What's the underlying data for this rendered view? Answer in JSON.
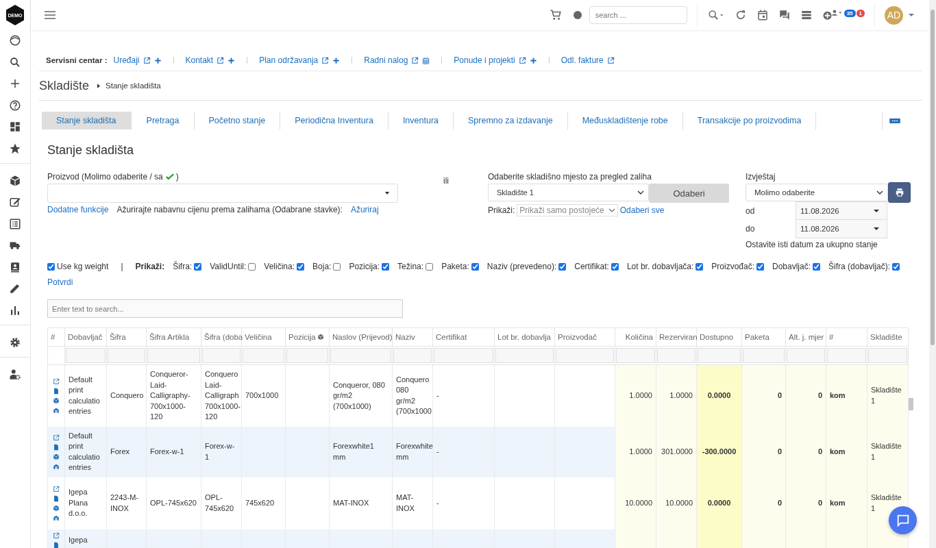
{
  "brand": {
    "logo": "DEMO"
  },
  "topbar": {
    "search": {
      "placeholder": "search ..."
    },
    "badges": [
      {
        "text": "35",
        "color": "#1f6fd6"
      },
      {
        "text": "1",
        "color": "#e5484d"
      }
    ],
    "avatar": "AD"
  },
  "service_center": {
    "label": "Servisni centar :",
    "links": [
      {
        "label": "Uređaji",
        "kind": "add"
      },
      {
        "label": "Kontakt",
        "kind": "add"
      },
      {
        "label": "Plan održavanja",
        "kind": "add"
      },
      {
        "label": "Radni nalog",
        "kind": "calendar"
      },
      {
        "label": "Ponude i projekti",
        "kind": "add"
      },
      {
        "label": "Odl. fakture",
        "kind": "link"
      }
    ]
  },
  "breadcrumb": {
    "title": "Skladište",
    "current": "Stanje skladišta"
  },
  "tabs": [
    {
      "label": "Stanje skladišta",
      "selected": true
    },
    {
      "label": "Pretraga",
      "selected": false
    },
    {
      "label": "Početno stanje",
      "selected": false
    },
    {
      "label": "Periodična Inventura",
      "selected": false
    },
    {
      "label": "Inventura",
      "selected": false
    },
    {
      "label": "Spremno za izdavanje",
      "selected": false
    },
    {
      "label": "Međuskladištenje robe",
      "selected": false
    },
    {
      "label": "Transakcije po proizvodima",
      "selected": false
    }
  ],
  "heading": "Stanje skladišta",
  "product": {
    "label": "Proizvod (Molimo odaberite / sa",
    "label_end": ")",
    "extra_link": "Dodatne funkcije",
    "update_text": "Ažurirajte nabavnu cijenu prema zalihama (Odabrane stavke):",
    "update_link": "Ažuriraj"
  },
  "or_text": "ili",
  "warehouse": {
    "label": "Odaberite skladišno mjesto za pregled zaliha",
    "value": "Skladište 1",
    "button": "Odaberi",
    "show_label": "Prikaži:",
    "show_value": "Prikaži samo postojeće",
    "select_all": "Odaberi sve"
  },
  "report": {
    "label": "Izvještaj",
    "value": "Molimo odaberite",
    "from_label": "od",
    "from": "11.08.2026",
    "to_label": "do",
    "to": "11.08.2026",
    "hint": "Ostavite isti datum za ukupno stanje"
  },
  "options": {
    "kg_weight": {
      "label": "Use kg weight",
      "checked": true
    },
    "separator": "|",
    "show_label": "Prikaži:",
    "fields": [
      {
        "label": "Šifra:",
        "checked": true
      },
      {
        "label": "ValidUntil:",
        "checked": false
      },
      {
        "label": "Veličina:",
        "checked": true
      },
      {
        "label": "Boja:",
        "checked": false
      },
      {
        "label": "Pozicija:",
        "checked": true
      },
      {
        "label": "Težina:",
        "checked": false
      },
      {
        "label": "Paketa:",
        "checked": true
      },
      {
        "label": "Naziv (prevedeno):",
        "checked": true
      },
      {
        "label": "Certifikat:",
        "checked": true
      },
      {
        "label": "Lot br. dobavljača:",
        "checked": true
      },
      {
        "label": "Proizvođač:",
        "checked": true
      },
      {
        "label": "Dobavljač:",
        "checked": true
      },
      {
        "label": "Šifra (dobavljač):",
        "checked": true
      }
    ],
    "confirm": "Potvrdi"
  },
  "table_search": {
    "placeholder": "Enter text to search..."
  },
  "table": {
    "columns": [
      {
        "label": "#",
        "kind": "actions"
      },
      {
        "label": "Dobavljač",
        "kind": "text"
      },
      {
        "label": "Šifra",
        "kind": "text"
      },
      {
        "label": "Šifra Artikla",
        "kind": "text"
      },
      {
        "label": "Šifra (doba",
        "kind": "text"
      },
      {
        "label": "Veličina",
        "kind": "text"
      },
      {
        "label": "Pozicija",
        "kind": "text-icon"
      },
      {
        "label": "Naslov (Prijevod)",
        "kind": "text"
      },
      {
        "label": "Naziv",
        "kind": "text"
      },
      {
        "label": "Certifikat",
        "kind": "text"
      },
      {
        "label": "Lot br. dobavlja",
        "kind": "text"
      },
      {
        "label": "Proizvođač",
        "kind": "text"
      },
      {
        "label": "Količina",
        "kind": "number"
      },
      {
        "label": "Rezerviran",
        "kind": "number"
      },
      {
        "label": "Dostupno",
        "kind": "available"
      },
      {
        "label": "Paketa",
        "kind": "count"
      },
      {
        "label": "Alt. j. mjer",
        "kind": "count"
      },
      {
        "label": "#",
        "kind": "unit"
      },
      {
        "label": "Skladište",
        "kind": "warehouse"
      }
    ],
    "rows": [
      {
        "cells": [
          "",
          "Default print calculatio entries",
          "Conquero",
          "Conqueror-Laid-Calligraphy-700x1000-120",
          "Conquero Laid-Calligraph 700x1000-120",
          "700x1000",
          null,
          "Conqueror, 080 gr/m2 (700x1000)",
          "Conquero 080 gr/m2 (700x1000",
          "-",
          null,
          null,
          "1.0000",
          "1.0000",
          "0.0000",
          "0",
          "0",
          "kom",
          "Skladište 1"
        ]
      },
      {
        "cells": [
          "",
          "Default print calculatio entries",
          "Forex",
          "Forex-w-1",
          "Forex-w-1",
          null,
          null,
          "Forexwhite1 mm",
          "Forexwhite mm",
          "-",
          null,
          null,
          "1.0000",
          "301.0000",
          "-300.0000",
          "0",
          "0",
          "kom",
          "Skladište 1"
        ]
      },
      {
        "cells": [
          "",
          "Igepa Plana d.o.o.",
          "2243-M-INOX",
          "OPL-745x620",
          "OPL-745x620",
          "745x620",
          null,
          "MAT-INOX",
          "MAT-INOX",
          "-",
          null,
          null,
          "10.0000",
          "10.0000",
          "0.0000",
          "0",
          "0",
          "kom",
          "Skladište 1"
        ]
      },
      {
        "cells": [
          "",
          "Igepa"
        ]
      }
    ]
  }
}
